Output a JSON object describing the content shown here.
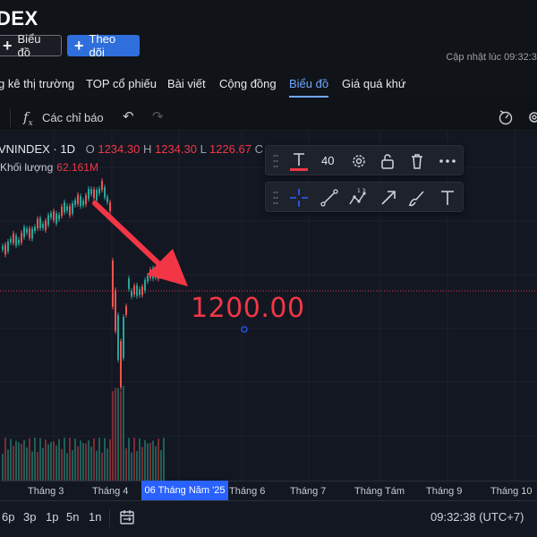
{
  "header": {
    "ticker": "DEX",
    "chart_button": "Biểu đồ",
    "follow_button": "Theo dõi",
    "updated": "Cập nhật lúc 09:32:38"
  },
  "nav": {
    "tabs": [
      {
        "label": "g kê thị trường"
      },
      {
        "label": "TOP cổ phiếu"
      },
      {
        "label": "Bài viết"
      },
      {
        "label": "Cộng đồng"
      },
      {
        "label": "Biểu đồ",
        "active": true
      },
      {
        "label": "Giá quá khứ"
      }
    ]
  },
  "toolbar": {
    "fx_symbol": "f",
    "indicators": "Các chỉ báo",
    "undo": "↶",
    "redo": "↷"
  },
  "legend": {
    "symbol": "VNINDEX · 1D",
    "open_label": "O",
    "open": "1234.30",
    "high_label": "H",
    "high": "1234.30",
    "low_label": "L",
    "low": "1226.67",
    "close_label": "C",
    "volume_label": "Khối lượng",
    "volume": "62.161M"
  },
  "drawing_toolbar": {
    "font_size": "40",
    "tools": [
      "text-tool",
      "settings",
      "lock",
      "delete",
      "more",
      "crosshair",
      "trend-line",
      "zigzag",
      "arrow",
      "brush",
      "text"
    ]
  },
  "annotation": {
    "text": "1200.00",
    "color": "#f23645"
  },
  "time_axis": {
    "labels": [
      "Tháng 3",
      "Tháng 4",
      "Tháng 6",
      "Tháng 7",
      "Tháng Tám",
      "Tháng 9",
      "Tháng 10"
    ],
    "cursor": "06 Tháng Năm '25"
  },
  "bottom_bar": {
    "timeframes": [
      "6p",
      "3p",
      "1p",
      "5n",
      "1n"
    ],
    "clock": "09:32:38 (UTC+7)"
  },
  "colors": {
    "up": "#26a69a",
    "down": "#ef5350",
    "accent": "#2962ff",
    "price_line": "#f23645"
  }
}
